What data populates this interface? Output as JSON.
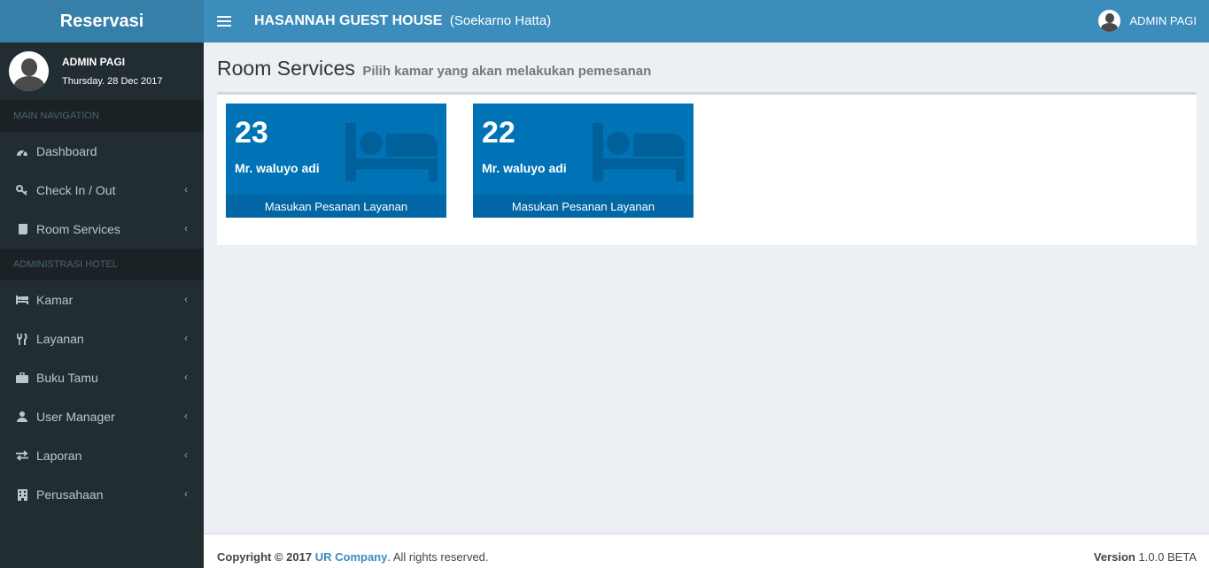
{
  "sidebar": {
    "logo": "Reservasi",
    "user": {
      "name": "ADMIN PAGI",
      "date": "Thursday. 28 Dec 2017"
    },
    "main_header": "MAIN NAVIGATION",
    "main_items": [
      {
        "label": "Dashboard",
        "icon": "dashboard-icon"
      },
      {
        "label": "Check In / Out",
        "icon": "key-icon"
      },
      {
        "label": "Room Services",
        "icon": "book-icon"
      }
    ],
    "admin_header": "ADMINISTRASI HOTEL",
    "admin_items": [
      {
        "label": "Kamar",
        "icon": "bed-icon"
      },
      {
        "label": "Layanan",
        "icon": "cutlery-icon"
      },
      {
        "label": "Buku Tamu",
        "icon": "briefcase-icon"
      },
      {
        "label": "User Manager",
        "icon": "user-icon"
      },
      {
        "label": "Laporan",
        "icon": "exchange-icon"
      },
      {
        "label": "Perusahaan",
        "icon": "building-icon"
      }
    ]
  },
  "header": {
    "title": "HASANNAH GUEST HOUSE",
    "subtitle": "(Soekarno Hatta)",
    "user": "ADMIN PAGI"
  },
  "page": {
    "title": "Room Services",
    "subtitle": "Pilih kamar yang akan melakukan pemesanan"
  },
  "rooms": [
    {
      "number": "23",
      "guest": "Mr. waluyo adi",
      "action": "Masukan Pesanan Layanan"
    },
    {
      "number": "22",
      "guest": "Mr. waluyo adi",
      "action": "Masukan Pesanan Layanan"
    }
  ],
  "footer": {
    "copyright": "Copyright © 2017",
    "company": "UR Company",
    "rights": ". All rights reserved.",
    "version_label": "Version",
    "version": "1.0.0 BETA"
  },
  "colors": {
    "header": "#3c8dbc",
    "logo": "#367fa9",
    "sidebar": "#222d32",
    "card": "#0073b7"
  }
}
